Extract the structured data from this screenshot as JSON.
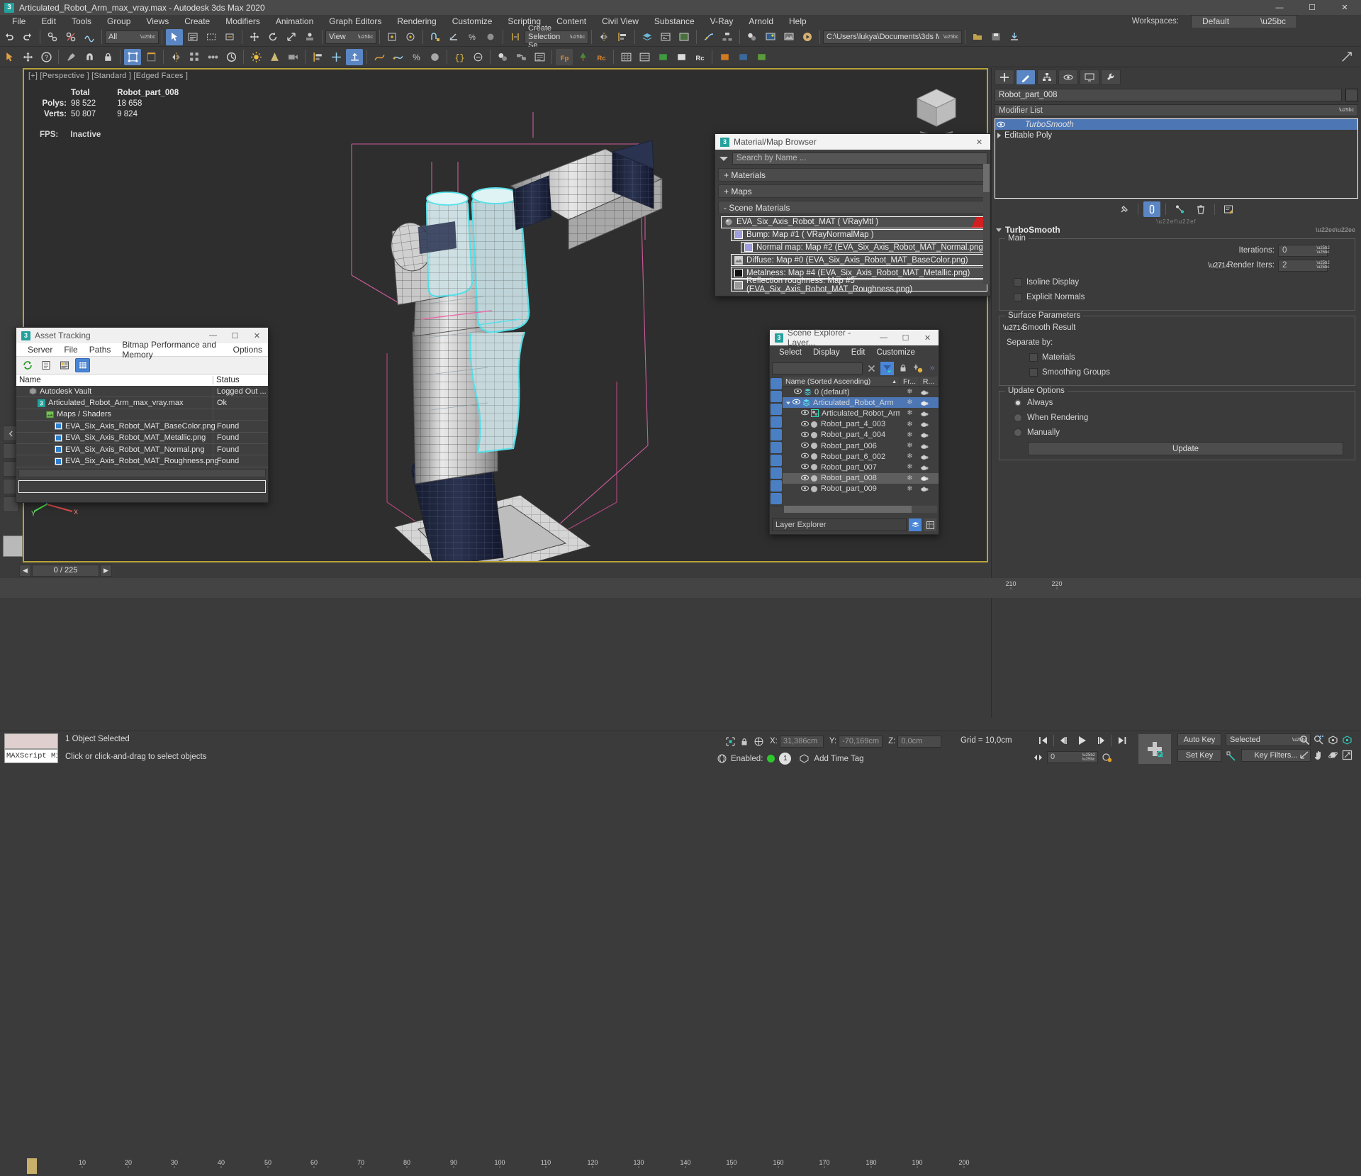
{
  "window": {
    "title": "Articulated_Robot_Arm_max_vray.max - Autodesk 3ds Max 2020",
    "app_icon": "3",
    "minimize": "—",
    "maximize": "☐",
    "close": "✕"
  },
  "menubar": {
    "items": [
      "File",
      "Edit",
      "Tools",
      "Group",
      "Views",
      "Create",
      "Modifiers",
      "Animation",
      "Graph Editors",
      "Rendering",
      "Customize",
      "Scripting",
      "Content",
      "Civil View",
      "Substance",
      "V-Ray",
      "Arnold",
      "Help"
    ]
  },
  "workspaces": {
    "label": "Workspaces:",
    "value": "Default"
  },
  "toolbar1": {
    "filter_all": "All",
    "view_mode": "View",
    "selection_set": "Create Selection Se",
    "project_path": "C:\\Users\\lukya\\Documents\\3ds Max 2022"
  },
  "viewport": {
    "label": "[+] [Perspective ] [Standard ] [Edged Faces ]",
    "stats": {
      "col_total": "Total",
      "col_object": "Robot_part_008",
      "polys_label": "Polys:",
      "polys_total": "98 522",
      "polys_object": "18 658",
      "verts_label": "Verts:",
      "verts_total": "50 807",
      "verts_object": "9 824",
      "fps_label": "FPS:",
      "fps_value": "Inactive"
    }
  },
  "material_browser": {
    "icon": "3",
    "title": "Material/Map Browser",
    "close": "✕",
    "search_placeholder": "Search by Name ...",
    "sections": [
      {
        "label": "+ Materials"
      },
      {
        "label": "+ Maps"
      },
      {
        "label": "- Scene Materials"
      }
    ],
    "tree": [
      {
        "label": "EVA_Six_Axis_Robot_MAT  ( VRayMtl )",
        "indent": 0,
        "swatch": "mtl",
        "flag": true
      },
      {
        "label": "Bump: Map #1  ( VRayNormalMap )",
        "indent": 1,
        "swatch": "#9f9ede",
        "flag": false
      },
      {
        "label": "Normal map: Map #2 (EVA_Six_Axis_Robot_MAT_Normal.png)",
        "indent": 2,
        "swatch": "#9f9ede",
        "flag": false
      },
      {
        "label": "Diffuse: Map #0 (EVA_Six_Axis_Robot_MAT_BaseColor.png)",
        "indent": 1,
        "swatch": "tex",
        "flag": false
      },
      {
        "label": "Metalness: Map #4 (EVA_Six_Axis_Robot_MAT_Metallic.png)",
        "indent": 1,
        "swatch": "dark",
        "flag": false
      },
      {
        "label": "Reflection roughness: Map #5 (EVA_Six_Axis_Robot_MAT_Roughness.png)",
        "indent": 1,
        "swatch": "grey",
        "flag": false
      }
    ]
  },
  "asset_tracking": {
    "icon": "3",
    "title": "Asset Tracking",
    "minimize": "—",
    "maximize": "☐",
    "close": "✕",
    "menu": [
      "Server",
      "File",
      "Paths",
      "Bitmap Performance and Memory",
      "Options"
    ],
    "columns": {
      "name": "Name",
      "status": "Status"
    },
    "rows": [
      {
        "name": "Autodesk Vault",
        "status": "Logged Out ...",
        "indent": 0,
        "icon": "vault"
      },
      {
        "name": "Articulated_Robot_Arm_max_vray.max",
        "status": "Ok",
        "indent": 1,
        "icon": "max"
      },
      {
        "name": "Maps / Shaders",
        "status": "",
        "indent": 2,
        "icon": "maps"
      },
      {
        "name": "EVA_Six_Axis_Robot_MAT_BaseColor.png",
        "status": "Found",
        "indent": 3,
        "icon": "png"
      },
      {
        "name": "EVA_Six_Axis_Robot_MAT_Metallic.png",
        "status": "Found",
        "indent": 3,
        "icon": "png"
      },
      {
        "name": "EVA_Six_Axis_Robot_MAT_Normal.png",
        "status": "Found",
        "indent": 3,
        "icon": "png"
      },
      {
        "name": "EVA_Six_Axis_Robot_MAT_Roughness.png",
        "status": "Found",
        "indent": 3,
        "icon": "png"
      }
    ]
  },
  "scene_explorer": {
    "icon": "3",
    "title": "Scene Explorer - Layer...",
    "minimize": "—",
    "maximize": "☐",
    "close": "✕",
    "menu": [
      "Select",
      "Display",
      "Edit",
      "Customize"
    ],
    "search_value": "",
    "overflow": "»",
    "columns": {
      "name": "Name (Sorted Ascending)",
      "sort": "▲",
      "frozen": "Fr...",
      "render": "R..."
    },
    "rows": [
      {
        "name": "0 (default)",
        "indent": 1,
        "type": "layer",
        "selected": false,
        "highlight": false
      },
      {
        "name": "Articulated_Robot_Arm",
        "indent": 1,
        "type": "layer",
        "selected": true,
        "highlight": false,
        "expander": true
      },
      {
        "name": "Articulated_Robot_Arm",
        "indent": 2,
        "type": "group",
        "selected": false,
        "highlight": false
      },
      {
        "name": "Robot_part_4_003",
        "indent": 2,
        "type": "object",
        "selected": false,
        "highlight": false
      },
      {
        "name": "Robot_part_4_004",
        "indent": 2,
        "type": "object",
        "selected": false,
        "highlight": false
      },
      {
        "name": "Robot_part_006",
        "indent": 2,
        "type": "object",
        "selected": false,
        "highlight": false
      },
      {
        "name": "Robot_part_6_002",
        "indent": 2,
        "type": "object",
        "selected": false,
        "highlight": false
      },
      {
        "name": "Robot_part_007",
        "indent": 2,
        "type": "object",
        "selected": false,
        "highlight": false
      },
      {
        "name": "Robot_part_008",
        "indent": 2,
        "type": "object",
        "selected": false,
        "highlight": true
      },
      {
        "name": "Robot_part_009",
        "indent": 2,
        "type": "object",
        "selected": false,
        "highlight": false
      }
    ],
    "layer_field": "Layer Explorer"
  },
  "command_panel": {
    "object_name": "Robot_part_008",
    "modifier_list": "Modifier List",
    "stack": [
      {
        "label": "TurboSmooth",
        "selected": true,
        "italic": true
      },
      {
        "label": "Editable Poly",
        "selected": false,
        "italic": false
      }
    ],
    "rollup_title": "TurboSmooth",
    "groups": {
      "main": {
        "title": "Main",
        "iterations_label": "Iterations:",
        "iterations_value": "0",
        "render_iters_label": "Render Iters:",
        "render_iters_value": "2",
        "render_iters_checked": true,
        "isoline_label": "Isoline Display",
        "isoline_checked": false,
        "explicit_label": "Explicit Normals",
        "explicit_checked": false
      },
      "surface": {
        "title": "Surface Parameters",
        "smooth_result_label": "Smooth Result",
        "smooth_result_checked": true,
        "separate_label": "Separate by:",
        "materials_label": "Materials",
        "materials_checked": false,
        "smoothing_groups_label": "Smoothing Groups",
        "smoothing_groups_checked": false
      },
      "update": {
        "title": "Update Options",
        "options": [
          {
            "label": "Always",
            "selected": true
          },
          {
            "label": "When Rendering",
            "selected": false
          },
          {
            "label": "Manually",
            "selected": false
          }
        ],
        "button": "Update"
      }
    }
  },
  "timeline": {
    "current_frame": "0 / 225",
    "prev": "◀",
    "next": "▶",
    "ticks": [
      "10",
      "20",
      "30",
      "40",
      "50",
      "60",
      "70",
      "80",
      "90",
      "100",
      "110",
      "120",
      "130",
      "140",
      "150",
      "160",
      "170",
      "180",
      "190",
      "200",
      "210",
      "220"
    ]
  },
  "statusbar": {
    "maxscript_label": "MAXScript Mi",
    "selection_status": "1 Object Selected",
    "prompt": "Click or click-and-drag to select objects",
    "x_label": "X:",
    "x_value": "31,386cm",
    "y_label": "Y:",
    "y_value": "-70,169cm",
    "z_label": "Z:",
    "z_value": "0,0cm",
    "grid": "Grid = 10,0cm",
    "enabled_label": "Enabled:",
    "enabled_count": "1",
    "add_time_tag": "Add Time Tag",
    "auto_key": "Auto Key",
    "set_key": "Set Key",
    "key_mode": "Selected",
    "key_filters": "Key Filters...",
    "frame_field": "0"
  },
  "colors": {
    "accent_blue": "#5b86c4",
    "select_blue": "#4d76b4",
    "viewport_border": "#b8a13a",
    "highlight_cyan": "#58e0e8",
    "magenta_gizmo": "#e060a8",
    "flag_red": "#d21f1f"
  }
}
